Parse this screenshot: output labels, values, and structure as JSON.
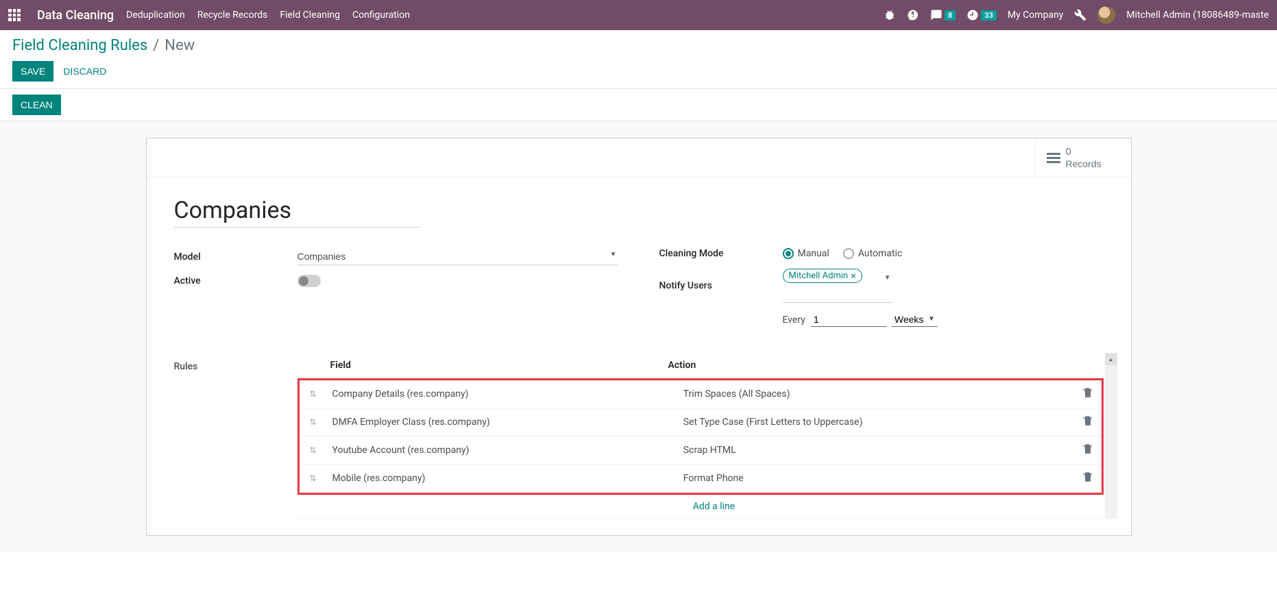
{
  "navbar": {
    "app_name": "Data Cleaning",
    "menu": [
      "Deduplication",
      "Recycle Records",
      "Field Cleaning",
      "Configuration"
    ],
    "msg_badge": "8",
    "clock_badge": "33",
    "company": "My Company",
    "user": "Mitchell Admin (18086489-maste"
  },
  "breadcrumb": {
    "parent": "Field Cleaning Rules",
    "current": "New"
  },
  "buttons": {
    "save": "Save",
    "discard": "Discard",
    "clean": "Clean"
  },
  "stat": {
    "count": "0",
    "label": "Records"
  },
  "form": {
    "title": "Companies",
    "labels": {
      "model": "Model",
      "active": "Active",
      "cleaning_mode": "Cleaning Mode",
      "notify_users": "Notify Users",
      "rules": "Rules",
      "every": "Every"
    },
    "model_value": "Companies",
    "mode_manual": "Manual",
    "mode_automatic": "Automatic",
    "notify_tag": "Mitchell Admin",
    "every_value": "1",
    "every_unit": "Weeks"
  },
  "rules_table": {
    "headers": {
      "field": "Field",
      "action": "Action"
    },
    "rows": [
      {
        "field": "Company Details (res.company)",
        "action": "Trim Spaces (All Spaces)"
      },
      {
        "field": "DMFA Employer Class (res.company)",
        "action": "Set Type Case (First Letters to Uppercase)"
      },
      {
        "field": "Youtube Account (res.company)",
        "action": "Scrap HTML"
      },
      {
        "field": "Mobile (res.company)",
        "action": "Format Phone"
      }
    ],
    "add_line": "Add a line"
  }
}
